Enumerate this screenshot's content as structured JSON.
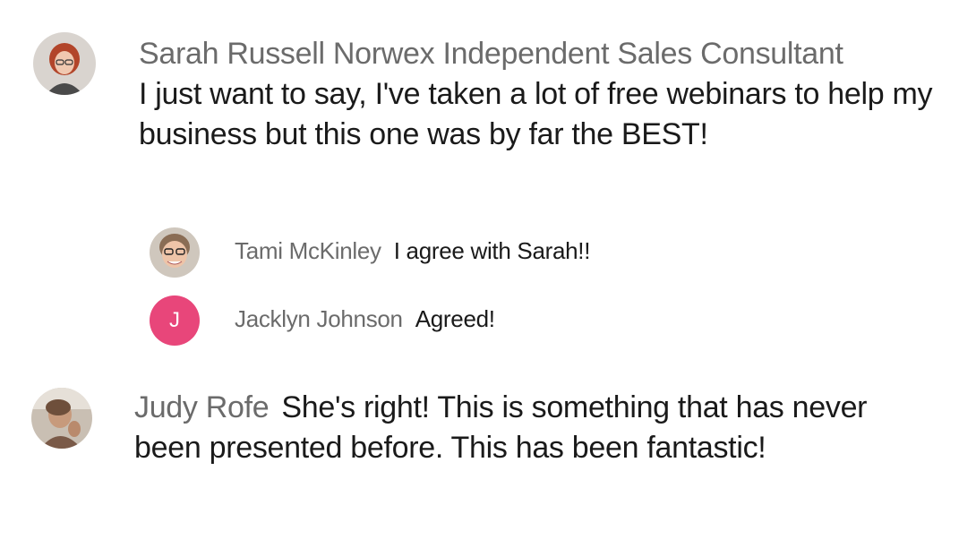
{
  "comments": [
    {
      "author": "Sarah Russell Norwex Independent Sales Consultant",
      "text": "I just want to say, I've taken a lot of free webinars to help my business but this one was by far the BEST!",
      "replies": [
        {
          "author": "Tami McKinley",
          "text": "I agree with Sarah!!"
        },
        {
          "author": "Jacklyn Johnson",
          "text": "Agreed!",
          "avatar_initial": "J",
          "avatar_color": "#e8467a"
        }
      ]
    },
    {
      "author": "Judy Rofe",
      "text": "She's right! This is something that has never been presented before. This has been fantastic!"
    }
  ],
  "colors": {
    "author": "#6b6b6b",
    "text": "#1a1a1a",
    "background": "#ffffff"
  }
}
